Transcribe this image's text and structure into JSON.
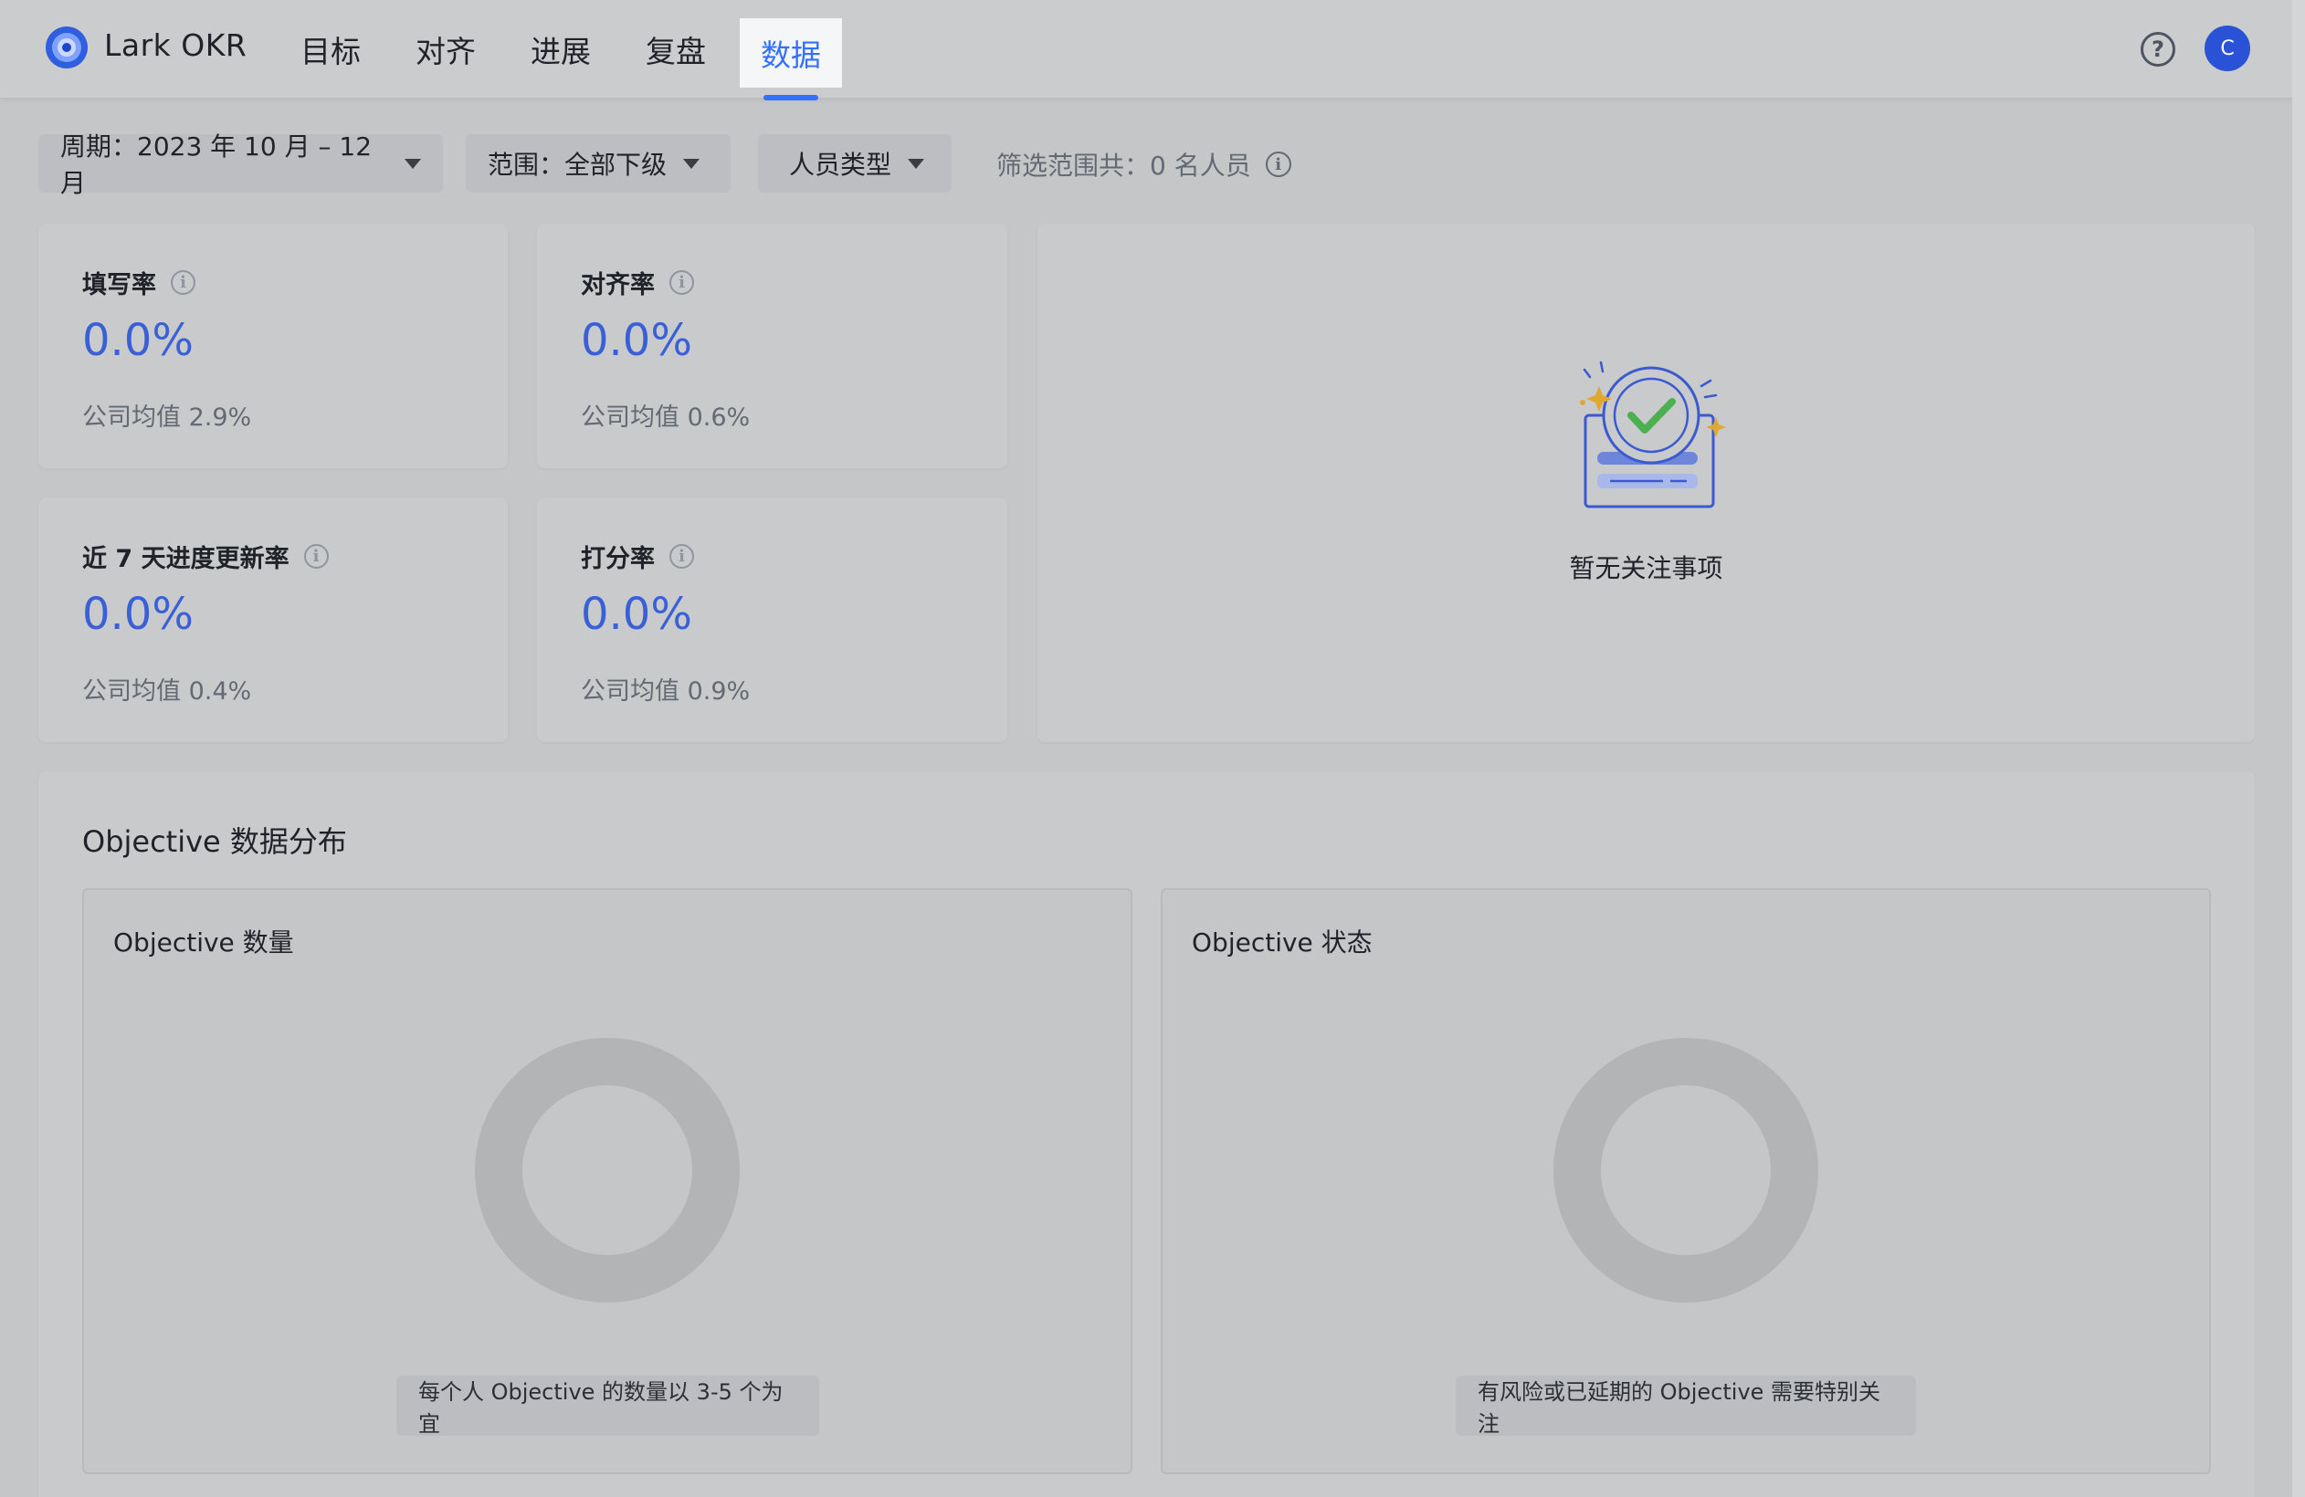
{
  "app": {
    "brand": "Lark OKR"
  },
  "nav": [
    {
      "label": "目标",
      "active": false
    },
    {
      "label": "对齐",
      "active": false
    },
    {
      "label": "进展",
      "active": false
    },
    {
      "label": "复盘",
      "active": false
    },
    {
      "label": "数据",
      "active": true
    }
  ],
  "header": {
    "avatar_initial": "C",
    "help_glyph": "?"
  },
  "filters": {
    "period": "周期：2023 年 10 月 – 12 月",
    "scope": "范围：全部下级",
    "person_type": "人员类型",
    "summary": "筛选范围共：0 名人员"
  },
  "stats": [
    {
      "title": "填写率",
      "value": "0.0%",
      "avg": "公司均值 2.9%"
    },
    {
      "title": "对齐率",
      "value": "0.0%",
      "avg": "公司均值 0.6%"
    },
    {
      "title": "近 7 天进度更新率",
      "value": "0.0%",
      "avg": "公司均值 0.4%"
    },
    {
      "title": "打分率",
      "value": "0.0%",
      "avg": "公司均值 0.9%"
    }
  ],
  "focus": {
    "empty_text": "暂无关注事项"
  },
  "distribution": {
    "title": "Objective 数据分布",
    "count_card": {
      "title": "Objective 数量",
      "tip": "每个人 Objective 的数量以 3-5 个为宜"
    },
    "status_card": {
      "title": "Objective 状态",
      "tip": "有风险或已延期的 Objective 需要特别关注"
    }
  },
  "colors": {
    "accent": "#3370ff",
    "value_blue": "#3a60d8",
    "avatar": "#2952d6",
    "check_green": "#4caf50",
    "sparkle": "#e0a82e"
  },
  "info_glyph": "i"
}
